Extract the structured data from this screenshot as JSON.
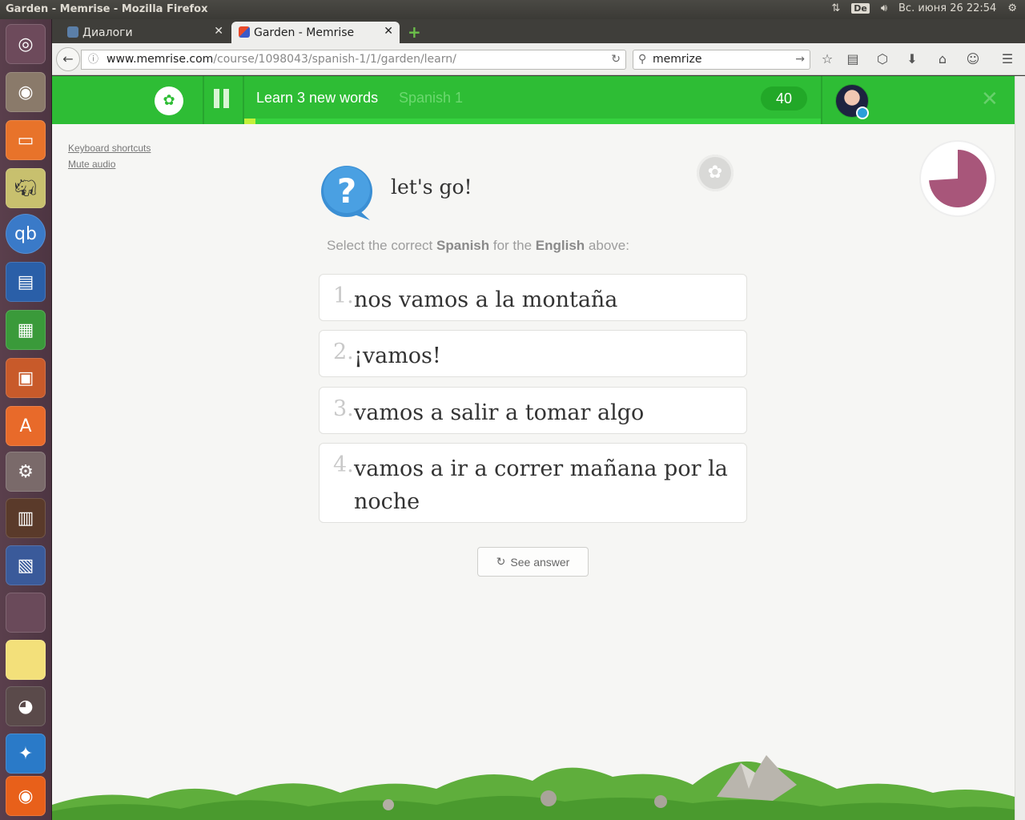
{
  "os_panel": {
    "window_title": "Garden - Memrise - Mozilla Firefox",
    "keyboard_layout": "De",
    "datetime": "Вс. июня 26 22:54"
  },
  "launcher": {
    "apps": [
      "ubuntu-dash",
      "sound-app",
      "files",
      "rhino-app",
      "qbittorrent",
      "libreoffice-writer",
      "libreoffice-calc",
      "libreoffice-impress",
      "software-center",
      "system-settings",
      "books-app",
      "book-reader",
      "workspace-switcher",
      "sticky-notes",
      "gimp",
      "remmina",
      "firefox"
    ]
  },
  "browser": {
    "tabs": [
      {
        "label": "Диалоги",
        "active": false
      },
      {
        "label": "Garden - Memrise",
        "active": true
      }
    ],
    "url_host": "www.memrise.com",
    "url_path": "/course/1098043/spanish-1/1/garden/learn/",
    "search_value": "memrize"
  },
  "header": {
    "session_title": "Learn 3 new words",
    "course_name": "Spanish 1",
    "score": "40",
    "progress": 0.02
  },
  "sidebar_links": {
    "keyboard_shortcuts": "Keyboard shortcuts",
    "mute_audio": "Mute audio"
  },
  "question": {
    "prompt": "let's go!",
    "instruction_pre": "Select the correct ",
    "instruction_lang_target": "Spanish",
    "instruction_mid": " for the ",
    "instruction_lang_source": "English",
    "instruction_post": " above:",
    "options": [
      {
        "num": "1.",
        "text": "nos vamos a la montaña"
      },
      {
        "num": "2.",
        "text": "¡vamos!"
      },
      {
        "num": "3.",
        "text": "vamos a salir a tomar algo"
      },
      {
        "num": "4.",
        "text": "vamos a ir a correr mañana por la noche"
      }
    ],
    "see_answer": "See answer"
  },
  "timer": {
    "remaining_fraction": 0.74,
    "color": "#a8567a"
  },
  "colors": {
    "brand_green": "#2ebd35",
    "progress_lime": "#c4f03a",
    "question_blue": "#3b8fd4"
  }
}
